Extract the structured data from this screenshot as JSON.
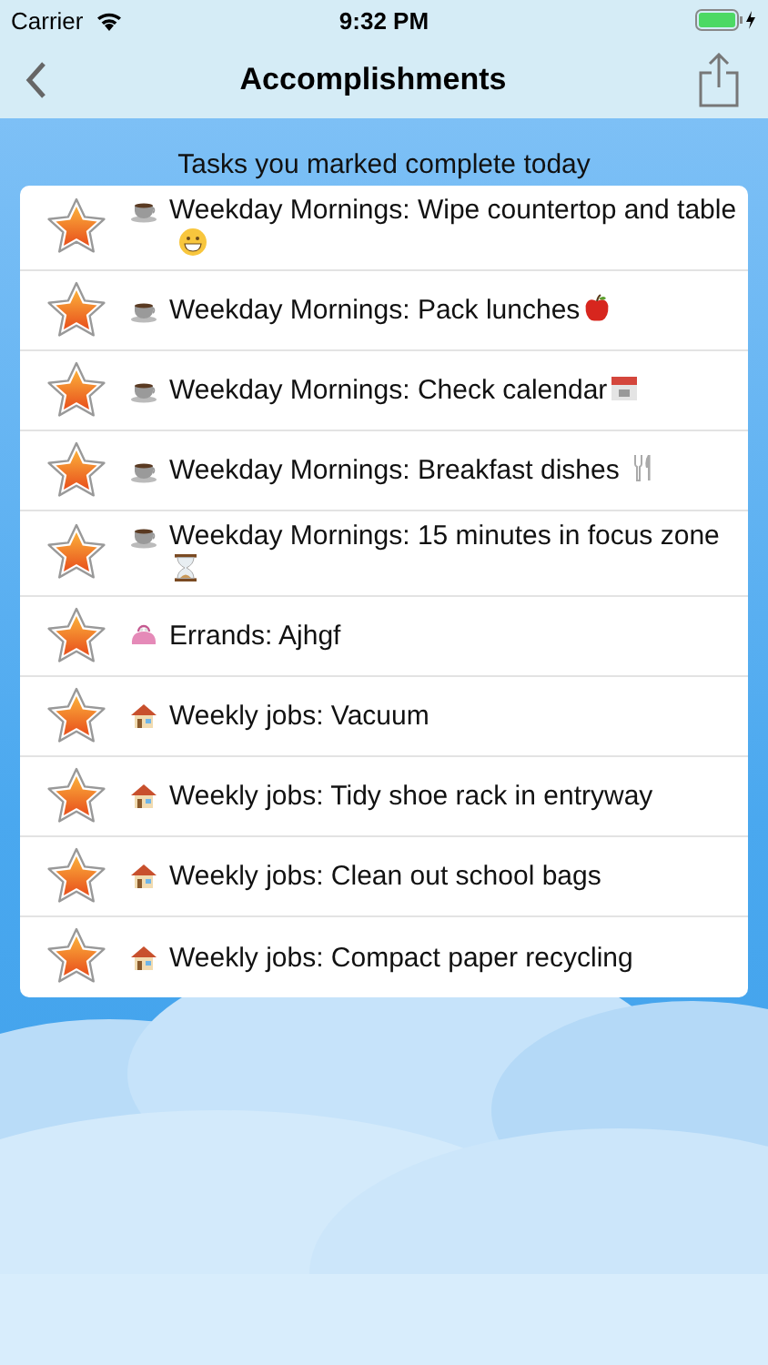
{
  "status_bar": {
    "carrier": "Carrier",
    "time": "9:32 PM"
  },
  "nav": {
    "title": "Accomplishments"
  },
  "heading": "Tasks you marked complete today",
  "tasks": [
    {
      "lead": {
        "kind": "cup"
      },
      "text": "Weekday Mornings: Wipe countertop and table",
      "trail": {
        "kind": "grin"
      }
    },
    {
      "lead": {
        "kind": "cup"
      },
      "text": "Weekday Mornings: Pack lunches",
      "trail": {
        "kind": "apple"
      }
    },
    {
      "lead": {
        "kind": "cup"
      },
      "text": "Weekday Mornings: Check calendar",
      "trail": {
        "kind": "calendar"
      }
    },
    {
      "lead": {
        "kind": "cup"
      },
      "text": "Weekday Mornings: Breakfast dishes",
      "trail": {
        "kind": "cutlery"
      }
    },
    {
      "lead": {
        "kind": "cup"
      },
      "text": "Weekday Mornings: 15 minutes in focus zone",
      "trail": {
        "kind": "hourglass"
      }
    },
    {
      "lead": {
        "kind": "purse"
      },
      "text": "Errands: Ajhgf"
    },
    {
      "lead": {
        "kind": "house"
      },
      "text": "Weekly jobs: Vacuum"
    },
    {
      "lead": {
        "kind": "house"
      },
      "text": "Weekly jobs: Tidy shoe rack in entryway"
    },
    {
      "lead": {
        "kind": "house"
      },
      "text": "Weekly jobs: Clean out school bags"
    },
    {
      "lead": {
        "kind": "house"
      },
      "text": "Weekly jobs: Compact paper recycling"
    }
  ]
}
